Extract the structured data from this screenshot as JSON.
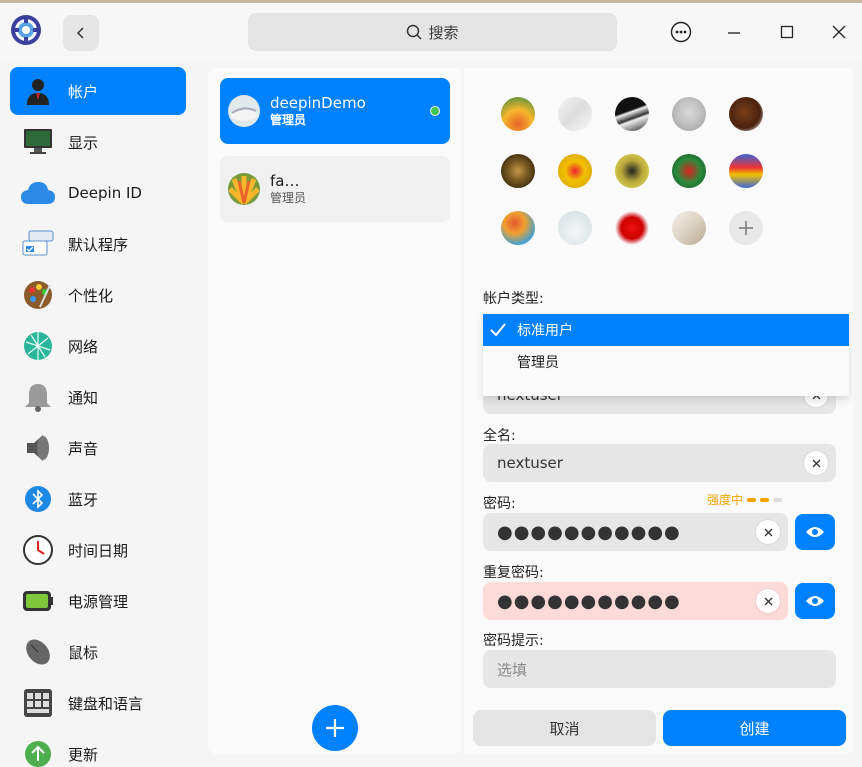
{
  "colors": {
    "accent": "#0081ff",
    "online": "#42c653",
    "warning": "#f0a400",
    "error_bg": "#fbdad8"
  },
  "header": {
    "search_label": "搜索",
    "search_icon": "search-icon",
    "back_icon": "chevron-left-icon",
    "menu_icon": "more-icon",
    "minimize_icon": "minimize-icon",
    "maximize_icon": "maximize-icon",
    "close_icon": "close-icon"
  },
  "sidebar": {
    "items": [
      {
        "label": "帐户",
        "icon": "user-icon",
        "active": true
      },
      {
        "label": "显示",
        "icon": "monitor-icon"
      },
      {
        "label": "Deepin ID",
        "icon": "cloud-icon"
      },
      {
        "label": "默认程序",
        "icon": "default-apps-icon"
      },
      {
        "label": "个性化",
        "icon": "palette-icon"
      },
      {
        "label": "网络",
        "icon": "network-icon"
      },
      {
        "label": "通知",
        "icon": "bell-icon"
      },
      {
        "label": "声音",
        "icon": "speaker-icon"
      },
      {
        "label": "蓝牙",
        "icon": "bluetooth-icon"
      },
      {
        "label": "时间日期",
        "icon": "clock-icon"
      },
      {
        "label": "电源管理",
        "icon": "battery-icon"
      },
      {
        "label": "鼠标",
        "icon": "mouse-icon"
      },
      {
        "label": "键盘和语言",
        "icon": "keyboard-icon"
      },
      {
        "label": "更新",
        "icon": "update-icon"
      }
    ]
  },
  "users": [
    {
      "name": "deepinDemo",
      "role": "管理员",
      "online": true
    },
    {
      "name": "fa…",
      "role": "管理员",
      "online": false
    }
  ],
  "form": {
    "account_type_label": "帐户类型:",
    "account_type_options": [
      "标准用户",
      "管理员"
    ],
    "account_type_selected": "标准用户",
    "username_value": "nextuser",
    "fullname_label": "全名:",
    "fullname_value": "nextuser",
    "password_label": "密码:",
    "password_value": "●●●●●●●●●●●",
    "strength_label": "强度中",
    "strength_level": 2,
    "strength_max": 3,
    "repeat_label": "重复密码:",
    "repeat_value": "●●●●●●●●●●●",
    "hint_label": "密码提示:",
    "hint_placeholder": "选填",
    "cancel_label": "取消",
    "create_label": "创建"
  }
}
